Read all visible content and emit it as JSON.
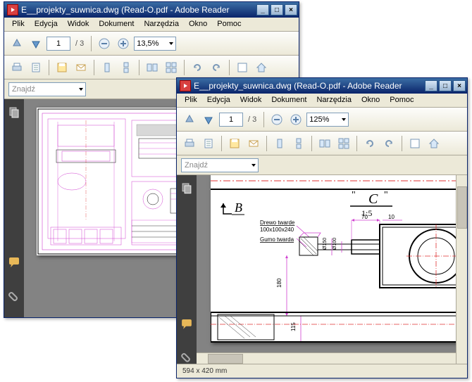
{
  "window_back": {
    "title": "E__projekty_suwnica.dwg (Read-O.pdf - Adobe Reader",
    "menu": {
      "file": "Plik",
      "edit": "Edycja",
      "view": "Widok",
      "document": "Dokument",
      "tools": "Narzędzia",
      "window": "Okno",
      "help": "Pomoc"
    },
    "page_current": "1",
    "page_total": "/ 3",
    "zoom": "13,5%",
    "find_placeholder": "Znajdź"
  },
  "window_front": {
    "title": "E__projekty_suwnica.dwg (Read-O.pdf - Adobe Reader",
    "menu": {
      "file": "Plik",
      "edit": "Edycja",
      "view": "Widok",
      "document": "Dokument",
      "tools": "Narzędzia",
      "window": "Okno",
      "help": "Pomoc"
    },
    "page_current": "1",
    "page_total": "/ 3",
    "zoom": "125%",
    "find_placeholder": "Znajdź",
    "status": "594 x 420 mm",
    "drawing": {
      "view_b": "B",
      "view_c": "C",
      "view_c_quotes": "\"",
      "scale": "1:5",
      "note1": "Drewo twarde",
      "note2": "100x100x240",
      "note3": "Gumo twarda",
      "dim_70": "70",
      "dim_10": "10",
      "dim_180": "180",
      "dim_115": "115",
      "dim_d100": "Ø100",
      "dim_d150": "Ø150"
    }
  }
}
